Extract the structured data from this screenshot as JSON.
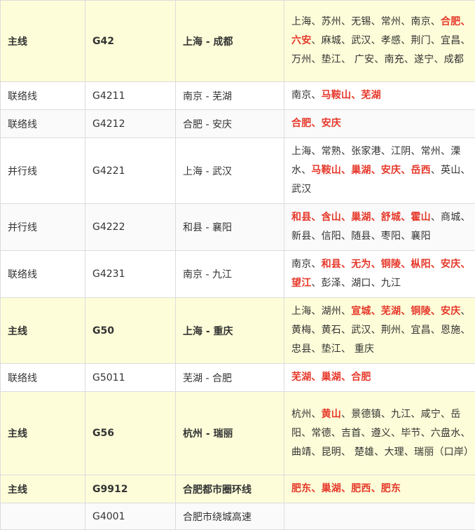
{
  "colors": {
    "highlight": "#e6382a",
    "main_row_bg": "#fdfdd9",
    "text": "#333333",
    "border": "#dcdcdc"
  },
  "rows": [
    {
      "type": "主线",
      "code": "G42",
      "route": "上海 - 成都",
      "main": true,
      "height": 116,
      "cities": [
        {
          "t": "上海、苏州、无锡、常州、南京、"
        },
        {
          "t": "合肥、六安",
          "hl": true
        },
        {
          "t": "、麻城、武汉、孝感、荆门、宜昌、万州、垫江、 广安、南充、遂宁、成都"
        }
      ]
    },
    {
      "type": "联络线",
      "code": "G4211",
      "route": "南京 - 芜湖",
      "main": false,
      "height": 38,
      "cities": [
        {
          "t": "南京、"
        },
        {
          "t": "马鞍山、芜湖",
          "hl": true
        }
      ]
    },
    {
      "type": "联络线",
      "code": "G4212",
      "route": "合肥 - 安庆",
      "main": false,
      "height": 38,
      "cities": [
        {
          "t": "合肥、安庆",
          "hl": true
        }
      ]
    },
    {
      "type": "并行线",
      "code": "G4221",
      "route": "上海 - 武汉",
      "main": false,
      "height": 92,
      "cities": [
        {
          "t": "上海、常熟、张家港、江阴、常州、溧水、"
        },
        {
          "t": "马鞍山、巢湖、安庆、岳西",
          "hl": true
        },
        {
          "t": "、英山、武汉"
        }
      ]
    },
    {
      "type": "并行线",
      "code": "G4222",
      "route": "和县 - 襄阳",
      "main": false,
      "height": 65,
      "cities": [
        {
          "t": "和县、含山、巢湖、舒城、霍山",
          "hl": true
        },
        {
          "t": "、商城、新县、信阳、随县、枣阳、襄阳"
        }
      ]
    },
    {
      "type": "联络线",
      "code": "G4231",
      "route": "南京 - 九江",
      "main": false,
      "height": 65,
      "cities": [
        {
          "t": "南京、"
        },
        {
          "t": "和县、无为、铜陵、枞阳、安庆、望江",
          "hl": true
        },
        {
          "t": "、彭泽、湖口、九江"
        }
      ]
    },
    {
      "type": "主线",
      "code": "G50",
      "route": "上海 - 重庆",
      "main": true,
      "height": 92,
      "cities": [
        {
          "t": "上海、湖州、"
        },
        {
          "t": "宣城、芜湖、铜陵、安庆",
          "hl": true
        },
        {
          "t": "、黄梅、黄石、武汉、荆州、宜昌、恩施、忠县、垫江、 重庆"
        }
      ]
    },
    {
      "type": "联络线",
      "code": "G5011",
      "route": "芜湖 - 合肥",
      "main": false,
      "height": 38,
      "cities": [
        {
          "t": "芜湖、巢湖、合肥",
          "hl": true
        }
      ]
    },
    {
      "type": "主线",
      "code": "G56",
      "route": "杭州 - 瑞丽",
      "main": true,
      "height": 119,
      "cities": [
        {
          "t": "杭州、"
        },
        {
          "t": "黄山",
          "hl": true
        },
        {
          "t": "、景德镇、九江、咸宁、岳阳、常德、吉首、遵义、毕节、六盘水、曲靖、昆明、 楚雄、大理、瑞丽（口岸）"
        }
      ]
    },
    {
      "type": "主线",
      "code": "G9912",
      "route": "合肥都市圈环线",
      "main": true,
      "height": 38,
      "cities": [
        {
          "t": "肥东、巢湖、肥西、肥东",
          "hl": true
        }
      ]
    },
    {
      "type": "",
      "code": "G4001",
      "route": "合肥市绕城高速",
      "main": false,
      "height": 38,
      "cities": []
    }
  ]
}
